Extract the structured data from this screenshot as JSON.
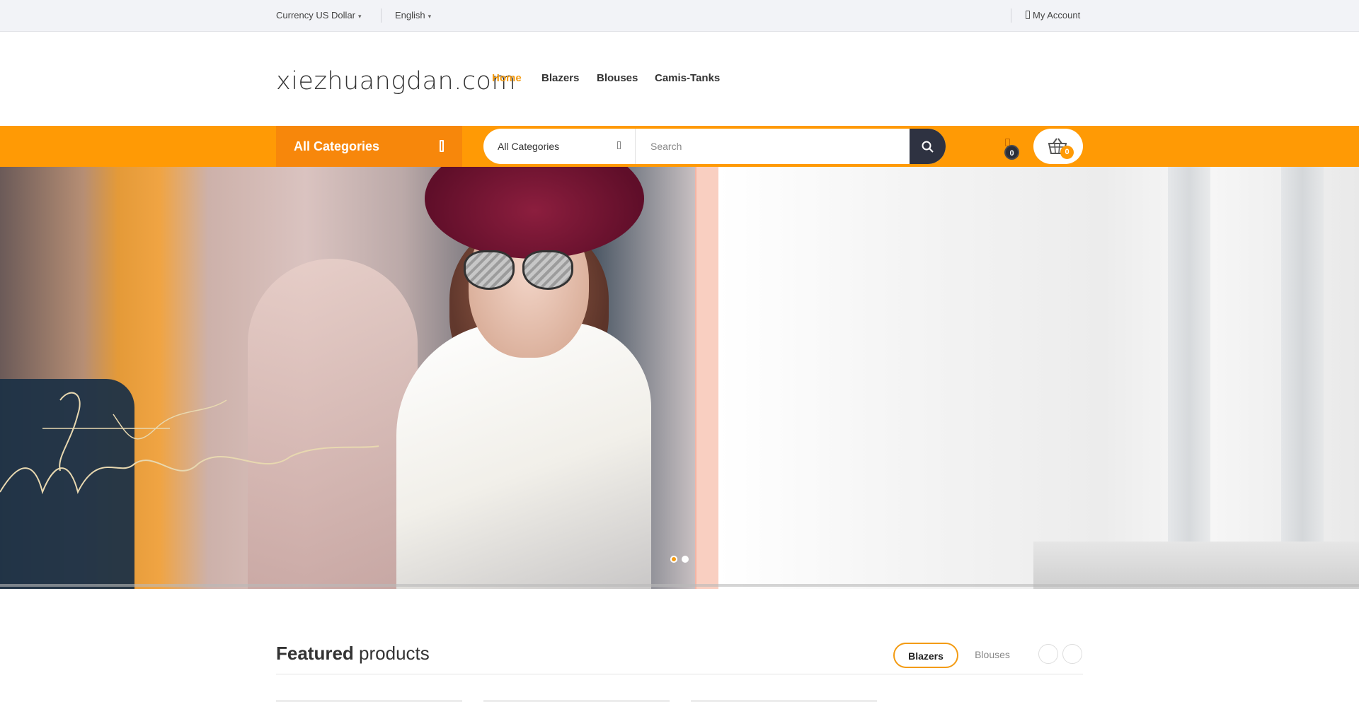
{
  "topbar": {
    "currency_label": "Currency",
    "currency_value": "US Dollar",
    "language": "English",
    "account": "My Account"
  },
  "header": {
    "logo": "xiezhuangdan.com",
    "nav": [
      {
        "label": "Home",
        "active": true
      },
      {
        "label": "Blazers",
        "active": false
      },
      {
        "label": "Blouses",
        "active": false
      },
      {
        "label": "Camis-Tanks",
        "active": false
      }
    ]
  },
  "searchbar": {
    "all_categories_button": "All Categories",
    "category_select": "All Categories",
    "placeholder": "Search",
    "compare_count": "0",
    "cart_count": "0"
  },
  "hero": {
    "slides": 2,
    "active_slide": 1
  },
  "featured": {
    "title_bold": "Featured",
    "title_rest": "products",
    "tabs": [
      {
        "label": "Blazers",
        "active": true
      },
      {
        "label": "Blouses",
        "active": false
      }
    ]
  },
  "colors": {
    "accent": "#ff9a05",
    "accent_dark": "#f7870b",
    "nav_active": "#f39b12",
    "dark": "#2e3241"
  }
}
